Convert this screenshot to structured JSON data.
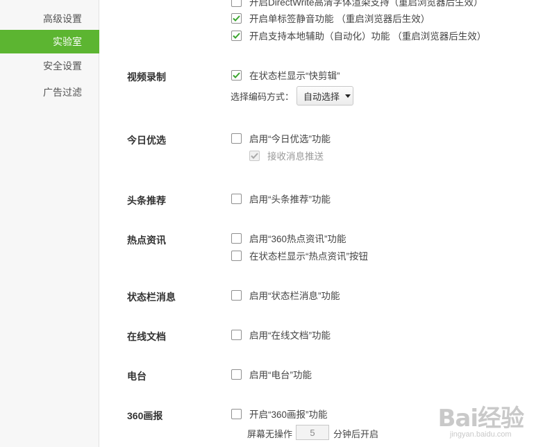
{
  "sidebar": {
    "items": [
      {
        "label": "高级设置",
        "active": false
      },
      {
        "label": "实验室",
        "active": true
      },
      {
        "label": "安全设置",
        "active": false
      },
      {
        "label": "广告过滤",
        "active": false
      }
    ]
  },
  "top_options": {
    "directwrite": {
      "label": "开启DirectWrite高清字体渲染支持（重启浏览器后生效）",
      "checked": false
    },
    "tab_mute": {
      "label": "开启单标签静音功能 （重启浏览器后生效）",
      "checked": true
    },
    "local_assist": {
      "label": "开启支持本地辅助（自动化）功能 （重启浏览器后生效）",
      "checked": true
    }
  },
  "video_recording": {
    "title": "视频录制",
    "show_in_statusbar": {
      "label": "在状态栏显示“快剪辑”",
      "checked": true
    },
    "encoding_label": "选择编码方式：",
    "encoding_value": "自动选择"
  },
  "daily_picks": {
    "title": "今日优选",
    "enable": {
      "label": "启用“今日优选”功能",
      "checked": false
    },
    "receive_push": {
      "label": "接收消息推送",
      "checked": true,
      "disabled": true
    }
  },
  "headline": {
    "title": "头条推荐",
    "enable": {
      "label": "启用“头条推荐”功能",
      "checked": false
    }
  },
  "hot_news": {
    "title": "热点资讯",
    "enable": {
      "label": "启用“360热点资讯”功能",
      "checked": false
    },
    "statusbar_button": {
      "label": "在状态栏显示“热点资讯”按钮",
      "checked": false
    }
  },
  "statusbar_message": {
    "title": "状态栏消息",
    "enable": {
      "label": "启用“状态栏消息”功能",
      "checked": false
    }
  },
  "online_docs": {
    "title": "在线文档",
    "enable": {
      "label": "启用“在线文档”功能",
      "checked": false
    }
  },
  "radio": {
    "title": "电台",
    "enable": {
      "label": "启用“电台”功能",
      "checked": false
    }
  },
  "pictorial": {
    "title": "360画报",
    "enable": {
      "label": "开启“360画报”功能",
      "checked": false
    },
    "idle_prefix": "屏幕无操作",
    "idle_minutes": "5",
    "idle_suffix": "分钟后开启"
  },
  "watermark": {
    "logo": "Bai经验",
    "sub": "jingyan.baidu.com"
  },
  "colors": {
    "accent": "#5cb531",
    "check": "#3aa52e"
  }
}
